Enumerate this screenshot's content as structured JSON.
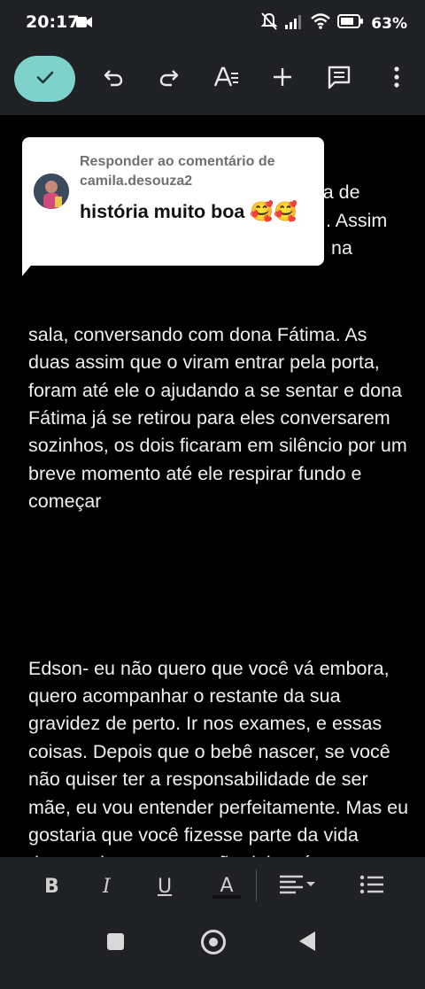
{
  "status": {
    "time": "20:17",
    "battery": "63%",
    "icons": [
      "camera-icon",
      "mute-icon",
      "signal-icon",
      "wifi-icon",
      "battery-icon"
    ]
  },
  "toolbar": {
    "icons": [
      "check-icon",
      "undo-icon",
      "redo-icon",
      "text-format-icon",
      "add-icon",
      "comment-icon",
      "more-vert-icon"
    ],
    "accent": "#7fd1cc"
  },
  "comment": {
    "header": "Responder ao comentário de camila.desouza2",
    "body": "história muito boa 🥰🥰"
  },
  "document": {
    "partial_lines": [
      "ava de",
      ". Assim",
      "na"
    ],
    "paragraph1": "sala, conversando com dona Fátima. As duas assim que o viram entrar pela porta, foram até ele o ajudando a se sentar e dona Fátima já se retirou para eles conversarem sozinhos, os dois ficaram em silêncio por um breve momento até ele respirar fundo e começar",
    "paragraph2": "Edson- eu não quero que você vá embora, quero acompanhar o restante da sua gravidez de perto. Ir nos exames, e essas coisas. Depois que o bebê nascer, se você não quiser ter a responsabilidade de ser mãe, eu vou entender perfeitamente. Mas eu gostaria que você fizesse parte da vida dessa criança como mãe dela, só que eu não posso te obrigar a isso tem que ser uma escolha sua, se decidir ficar será sempre muito bem tratada"
  },
  "format_bar": {
    "bold": "B",
    "italic": "I",
    "underline": "U",
    "text_color": "A",
    "icons": [
      "align-icon",
      "list-icon"
    ]
  },
  "nav": {
    "icons": [
      "recents-icon",
      "home-icon",
      "back-icon"
    ]
  }
}
